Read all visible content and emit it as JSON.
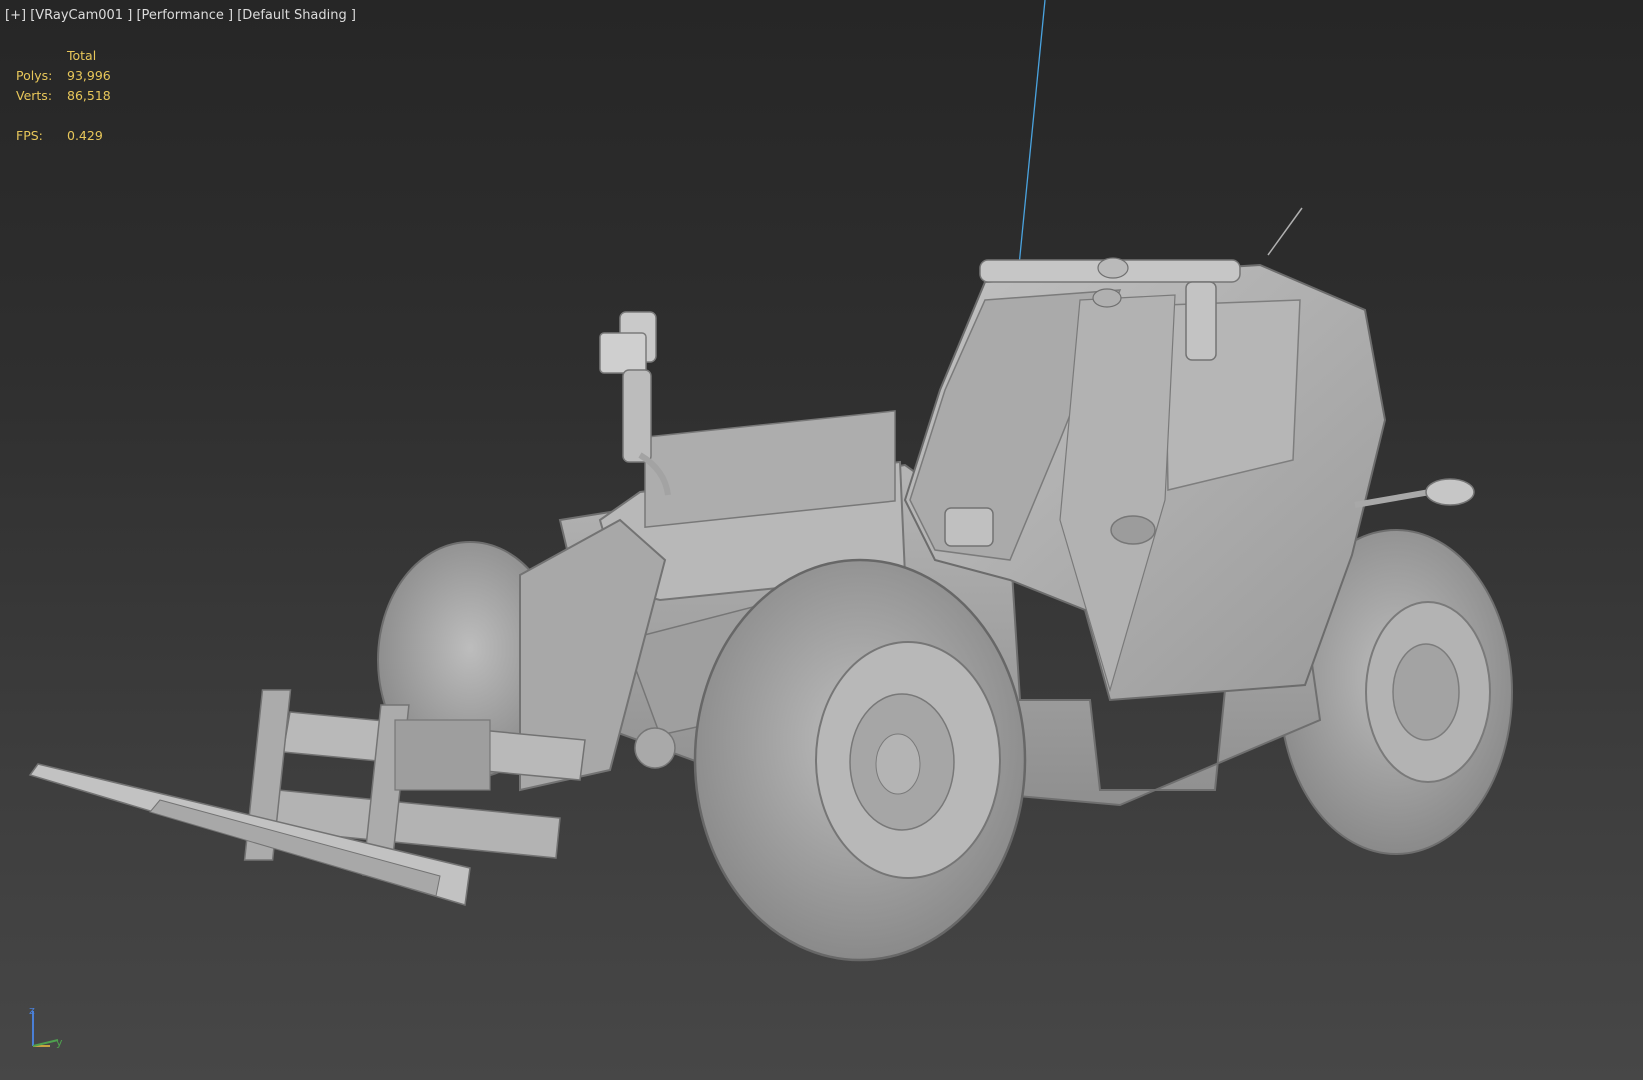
{
  "viewport": {
    "plus_menu": "[+]",
    "camera_menu": "[VRayCam001 ]",
    "display_menu": "[Performance ]",
    "shading_menu": "[Default Shading ]"
  },
  "stats": {
    "header": "Total",
    "polys_label": "Polys:",
    "polys_value": "93,996",
    "verts_label": "Verts:",
    "verts_value": "86,518",
    "fps_label": "FPS:",
    "fps_value": "0.429",
    "color": "#e8c75a"
  },
  "axis_gizmo": {
    "z_label": "z",
    "y_label": "y",
    "z_color": "#4a7fd6",
    "x_color": "#c9a340",
    "y_color": "#4fa14f"
  },
  "colors": {
    "background_top": "#262626",
    "background_bottom": "#474747",
    "model": "#a6a6a6",
    "camera_line": "#4aa3df"
  }
}
